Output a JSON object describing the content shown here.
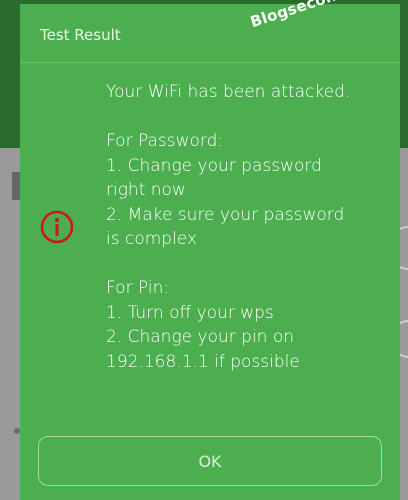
{
  "dialog": {
    "title": "Test Result",
    "watermark": "Blogsecond.com",
    "icon": "alert-info-icon",
    "message": {
      "headline": "Your WiFi has been attacked.",
      "password_heading": "For Password:",
      "password_steps": [
        "1. Change your password",
        "right now",
        "2. Make sure your password",
        "is complex"
      ],
      "pin_heading": "For Pin:",
      "pin_steps": [
        "1. Turn off your wps",
        "2. Change your pin on",
        "192.168.1.1 if possible"
      ]
    },
    "ok_label": "OK",
    "accent_color": "#4cae4f",
    "icon_color": "#d3141f"
  }
}
